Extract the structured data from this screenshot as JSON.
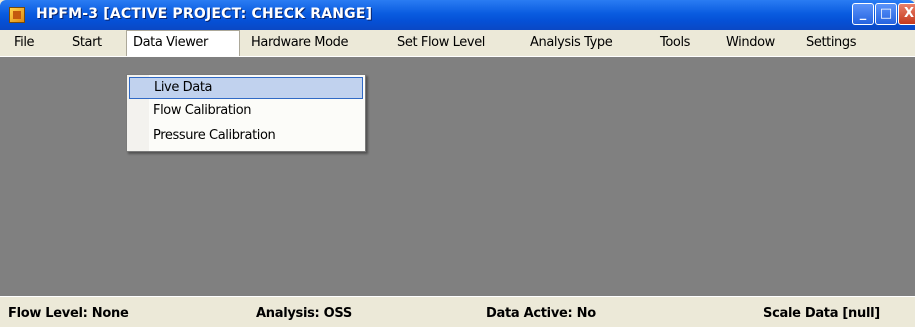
{
  "window": {
    "title": "HPFM-3  [ACTIVE PROJECT: CHECK RANGE]",
    "min_glyph": "_",
    "max_glyph": "□",
    "close_glyph": "X"
  },
  "menu": {
    "items": [
      "File",
      "Start",
      "Data Viewer",
      "Hardware Mode",
      "Set Flow Level",
      "Analysis Type",
      "Tools",
      "Window",
      "Settings"
    ],
    "open": "Data Viewer",
    "dropdown": [
      "Live Data",
      "Flow Calibration",
      "Pressure Calibration"
    ],
    "highlighted": "Live Data"
  },
  "status": {
    "flow_level": "Flow Level: None",
    "analysis": "Analysis: OSS",
    "data_active": "Data Active: No",
    "scale_data": "Scale Data  [null]"
  },
  "colors": {
    "title_bar": "#0a5ce0",
    "client_area": "#808080",
    "menu_highlight": "#c1d2ee"
  },
  "icons": [
    "app-icon",
    "minimize-icon",
    "maximize-icon",
    "close-icon"
  ]
}
